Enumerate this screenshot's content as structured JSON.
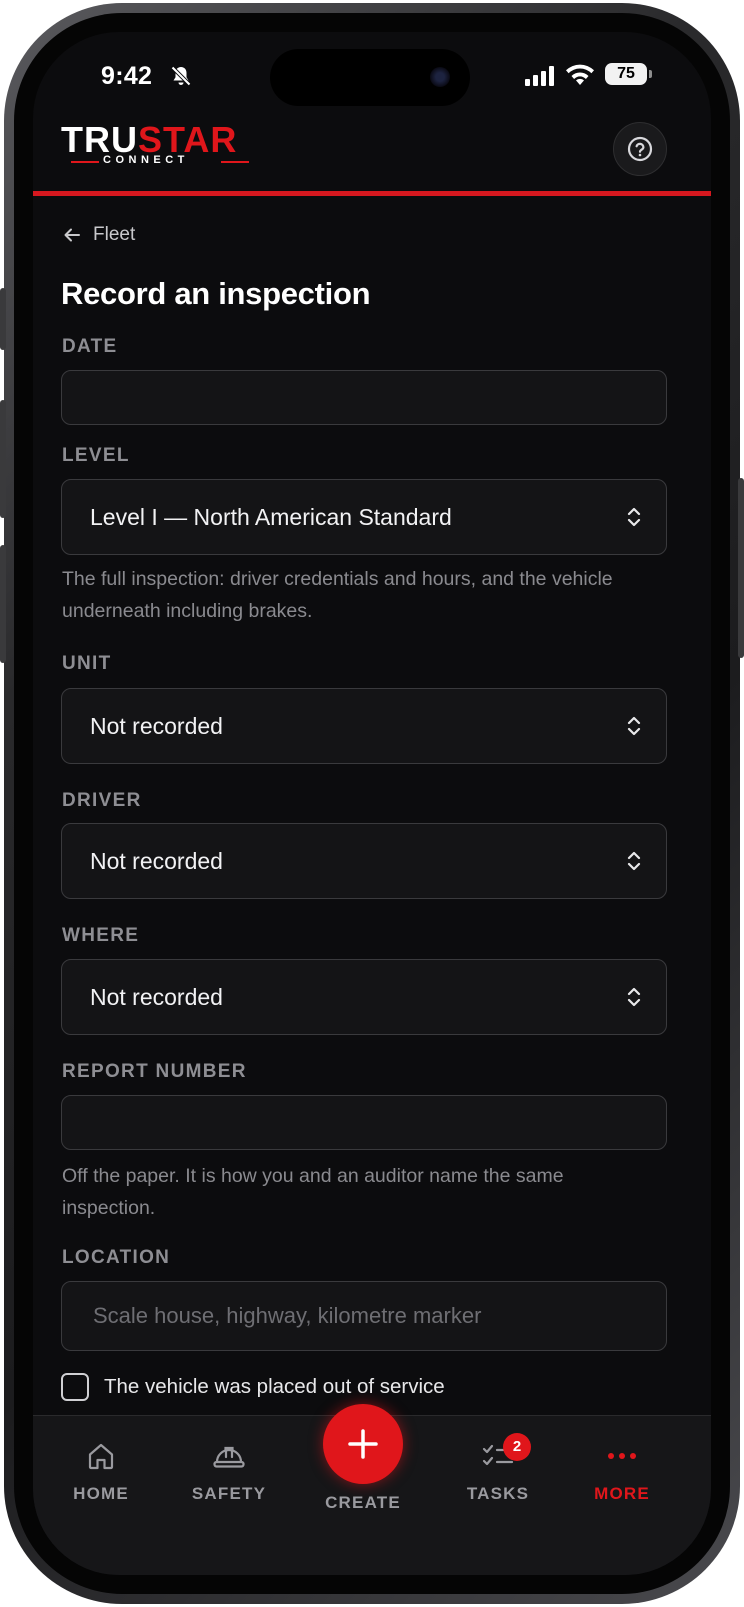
{
  "status_bar": {
    "time": "9:42",
    "battery": "75"
  },
  "header": {
    "logo_part1": "TRU",
    "logo_part2": "STAR",
    "logo_sub": "CONNECT"
  },
  "nav": {
    "back_label": "Fleet"
  },
  "page": {
    "title": "Record an inspection"
  },
  "form": {
    "date": {
      "label": "DATE",
      "value": ""
    },
    "level": {
      "label": "LEVEL",
      "value": "Level I — North American Standard",
      "help": "The full inspection: driver credentials and hours, and the vehicle underneath including brakes."
    },
    "unit": {
      "label": "UNIT",
      "value": "Not recorded"
    },
    "driver": {
      "label": "DRIVER",
      "value": "Not recorded"
    },
    "where": {
      "label": "WHERE",
      "value": "Not recorded"
    },
    "report_number": {
      "label": "REPORT NUMBER",
      "value": "",
      "help": "Off the paper. It is how you and an auditor name the same inspection."
    },
    "location": {
      "label": "LOCATION",
      "placeholder": "Scale house, highway, kilometre marker"
    },
    "out_of_service": {
      "label": "The vehicle was placed out of service",
      "checked": false
    }
  },
  "tab_bar": {
    "home": "HOME",
    "safety": "SAFETY",
    "create": "CREATE",
    "tasks": "TASKS",
    "tasks_badge": "2",
    "more": "MORE",
    "active_tab": "more"
  },
  "colors": {
    "accent": "#e0161b",
    "background": "#0c0c0e",
    "field_background": "#141416"
  }
}
